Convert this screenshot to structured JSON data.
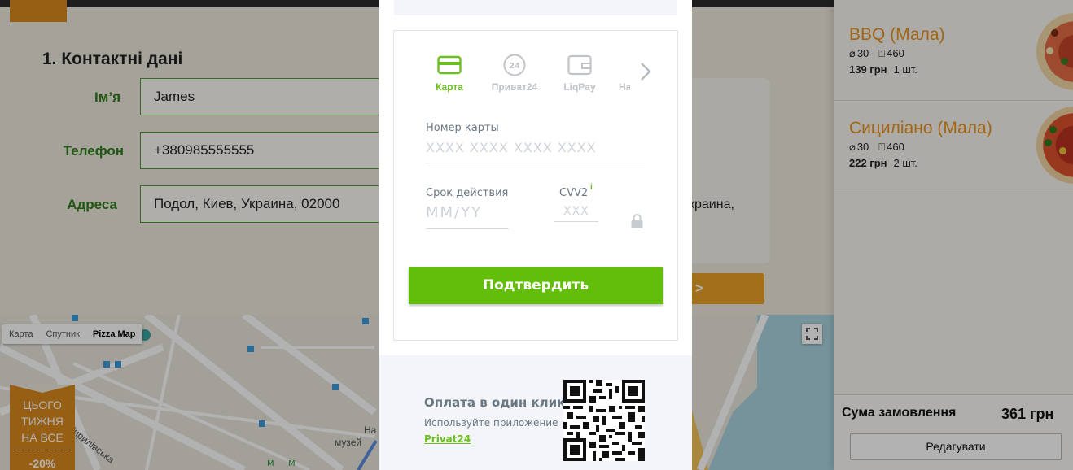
{
  "contact_form": {
    "title": "1. Контактні дані",
    "fields": [
      {
        "label": "Ім’я",
        "value": "James"
      },
      {
        "label": "Телефон",
        "value": "+380985555555"
      },
      {
        "label": "Адреса",
        "value": "Подол, Киев, Украина, 02000"
      }
    ],
    "side_text": [
      ".",
      "краина,"
    ],
    "next_button": ">"
  },
  "map": {
    "types": [
      "Карта",
      "Спутник",
      "Pizza Map"
    ],
    "active_type": "Pizza Map",
    "labels": [
      "Кирилівська",
      "музей",
      "На"
    ]
  },
  "promo": {
    "lines": [
      "ЦЬОГО",
      "ТИЖНЯ",
      "НА ВСЕ"
    ],
    "discount": "-20%"
  },
  "cart": {
    "items": [
      {
        "name": "BBQ (Мала)",
        "diameter": "30",
        "weight": "460",
        "price": "139 грн",
        "qty": "1  шт."
      },
      {
        "name": "Сициліано (Мала)",
        "diameter": "30",
        "weight": "460",
        "price": "222 грн",
        "qty": "2  шт."
      }
    ],
    "sum_label": "Сума замовлення",
    "sum_value": "361 грн",
    "edit_button": "Редагувати"
  },
  "payment": {
    "methods": [
      {
        "label": "Карта",
        "icon": "card-icon",
        "active": true
      },
      {
        "label": "Приват24",
        "icon": "privat24-icon",
        "active": false
      },
      {
        "label": "LiqPay",
        "icon": "wallet-icon",
        "active": false
      },
      {
        "label": "На",
        "icon": "more-icon",
        "active": false
      }
    ],
    "card_number_label": "Номер карты",
    "card_number_placeholder": "XXXX XXXX XXXX XXXX",
    "expiry_label": "Срок действия",
    "expiry_placeholder": "MM/YY",
    "cvv_label": "CVV2",
    "cvv_info": "i",
    "cvv_placeholder": "XXX",
    "confirm_button": "Подтвердить",
    "one_click_title": "Оплата в один клик",
    "one_click_subtitle": "Используйте приложение",
    "one_click_link": "Privat24"
  },
  "colors": {
    "accent_green": "#63be0b",
    "brand_orange": "#e8911c",
    "form_green": "#2f7d1a"
  }
}
